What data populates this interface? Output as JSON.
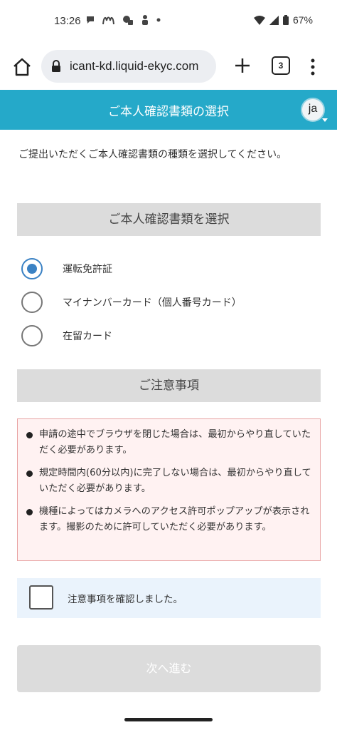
{
  "status_bar": {
    "time": "13:26",
    "battery": "67%"
  },
  "browser": {
    "url": "icant-kd.liquid-ekyc.com",
    "tab_count": "3"
  },
  "header": {
    "title": "ご本人確認書類の選択",
    "language": "ja"
  },
  "intro": "ご提出いただくご本人確認書類の種類を選択してください。",
  "document_section": {
    "title": "ご本人確認書類を選択",
    "options": [
      {
        "label": "運転免許証",
        "selected": true
      },
      {
        "label": "マイナンバーカード（個人番号カード）",
        "selected": false
      },
      {
        "label": "在留カード",
        "selected": false
      }
    ]
  },
  "notes_section": {
    "title": "ご注意事項",
    "items": [
      "申請の途中でブラウザを閉じた場合は、最初からやり直していただく必要があります。",
      "規定時間内(60分以内)に完了しない場合は、最初からやり直していただく必要があります。",
      "機種によってはカメラへのアクセス許可ポップアップが表示されます。撮影のために許可していただく必要があります。"
    ]
  },
  "confirm": {
    "label": "注意事項を確認しました。",
    "checked": false
  },
  "next_button": "次へ進む",
  "colors": {
    "header_bg": "#25a9c9",
    "radio_selected": "#3b82c4",
    "notice_bg": "#fff2f2",
    "notice_border": "#e8a3a3",
    "confirm_bg": "#eaf3fc",
    "disabled_button": "#dcdcdc"
  }
}
